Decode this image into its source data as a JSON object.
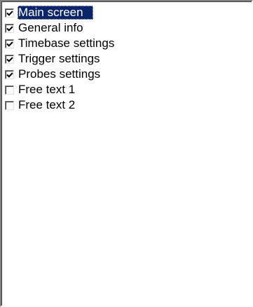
{
  "checklist": {
    "items": [
      {
        "label": "Main screen",
        "checked": true,
        "selected": true
      },
      {
        "label": "General info",
        "checked": true,
        "selected": false
      },
      {
        "label": "Timebase settings",
        "checked": true,
        "selected": false
      },
      {
        "label": "Trigger settings",
        "checked": true,
        "selected": false
      },
      {
        "label": "Probes settings",
        "checked": true,
        "selected": false
      },
      {
        "label": "Free text 1",
        "checked": false,
        "selected": false
      },
      {
        "label": "Free text 2",
        "checked": false,
        "selected": false
      }
    ]
  },
  "colors": {
    "selection_background": "#0a246a",
    "selection_text": "#ffffff",
    "text": "#000000",
    "background": "#ffffff"
  },
  "icons": {
    "checked": "checkmark-icon"
  }
}
